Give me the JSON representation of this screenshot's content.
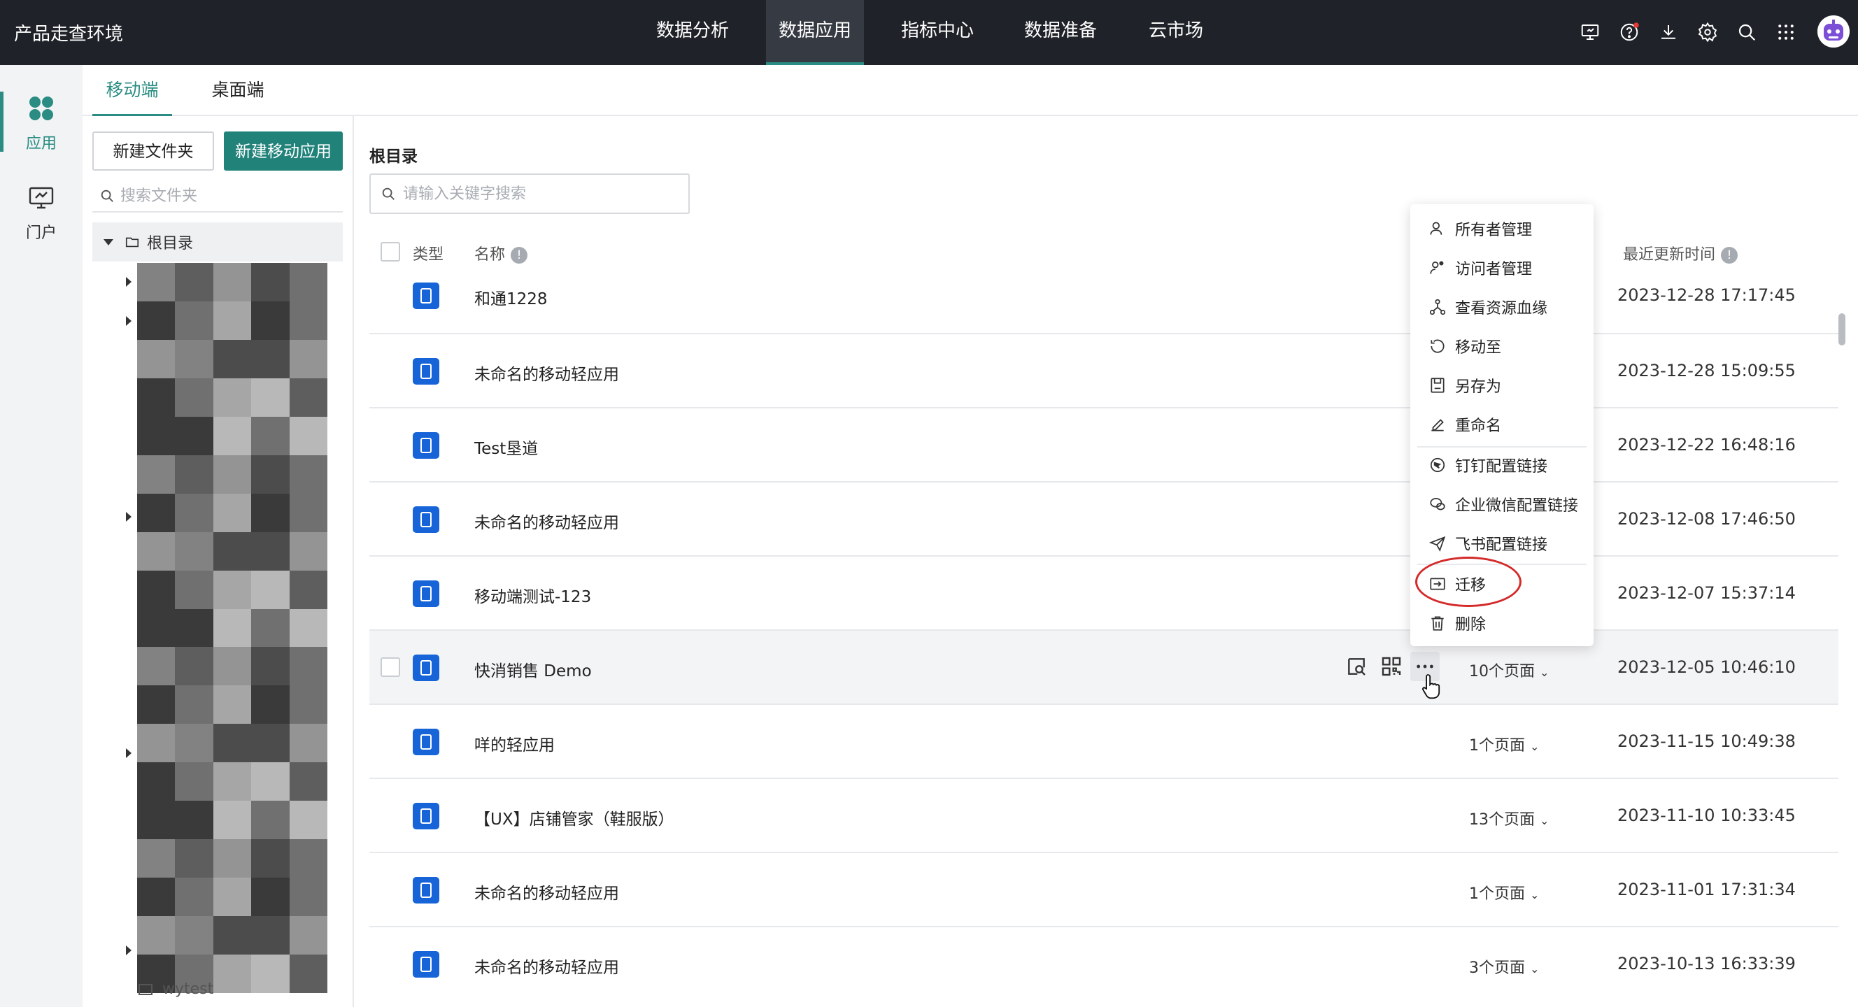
{
  "app": {
    "title": "产品走查环境"
  },
  "nav": {
    "items": [
      {
        "label": "数据分析",
        "active": false
      },
      {
        "label": "数据应用",
        "active": true
      },
      {
        "label": "指标中心",
        "active": false
      },
      {
        "label": "数据准备",
        "active": false
      },
      {
        "label": "云市场",
        "active": false
      }
    ]
  },
  "top_icons": [
    "screen-icon",
    "help-icon",
    "download-icon",
    "settings-icon",
    "search-icon",
    "apps-grid-icon"
  ],
  "left_rail": {
    "items": [
      {
        "label": "应用",
        "icon": "apps-icon",
        "active": true
      },
      {
        "label": "门户",
        "icon": "portal-icon",
        "active": false
      }
    ]
  },
  "tabs": [
    {
      "label": "移动端",
      "active": true
    },
    {
      "label": "桌面端",
      "active": false
    }
  ],
  "folder_panel": {
    "new_folder_label": "新建文件夹",
    "new_app_label": "新建移动应用",
    "search_placeholder": "搜索文件夹",
    "root_label": "根目录",
    "last_item_label": "wytest"
  },
  "main": {
    "breadcrumb": "根目录",
    "search_placeholder": "请输入关键字搜索",
    "headers": {
      "type": "类型",
      "name": "名称",
      "updated": "最近更新时间"
    },
    "rows": [
      {
        "name": "和通1228",
        "pages": "",
        "time": "2023-12-28 17:17:45"
      },
      {
        "name": "未命名的移动轻应用",
        "pages": "",
        "time": "2023-12-28 15:09:55"
      },
      {
        "name": "Test垦道",
        "pages": "",
        "time": "2023-12-22 16:48:16"
      },
      {
        "name": "未命名的移动轻应用",
        "pages": "",
        "time": "2023-12-08 17:46:50"
      },
      {
        "name": "移动端测试-123",
        "pages": "",
        "time": "2023-12-07 15:37:14"
      },
      {
        "name": "快消销售 Demo",
        "pages": "10个页面",
        "time": "2023-12-05 10:46:10"
      },
      {
        "name": "咩的轻应用",
        "pages": "1个页面",
        "time": "2023-11-15 10:49:38"
      },
      {
        "name": "【UX】店铺管家（鞋服版）",
        "pages": "13个页面",
        "time": "2023-11-10 10:33:45"
      },
      {
        "name": "未命名的移动轻应用",
        "pages": "1个页面",
        "time": "2023-11-01 17:31:34"
      },
      {
        "name": "未命名的移动轻应用",
        "pages": "3个页面",
        "time": "2023-10-13 16:33:39"
      }
    ]
  },
  "context_menu": {
    "items": [
      {
        "label": "所有者管理",
        "icon": "owner-icon"
      },
      {
        "label": "访问者管理",
        "icon": "visitor-icon"
      },
      {
        "label": "查看资源血缘",
        "icon": "lineage-icon"
      },
      {
        "label": "移动至",
        "icon": "move-icon"
      },
      {
        "label": "另存为",
        "icon": "save-as-icon"
      },
      {
        "label": "重命名",
        "icon": "rename-icon"
      },
      {
        "label": "钉钉配置链接",
        "icon": "dingtalk-icon"
      },
      {
        "label": "企业微信配置链接",
        "icon": "wecom-icon"
      },
      {
        "label": "飞书配置链接",
        "icon": "feishu-icon"
      },
      {
        "label": "迁移",
        "icon": "migrate-icon"
      },
      {
        "label": "删除",
        "icon": "delete-icon"
      }
    ]
  },
  "colors": {
    "topbar": "#1f2228",
    "accent": "#2a8c82",
    "primary_button": "#21827a",
    "app_icon": "#1664d8",
    "annotation": "#d42a2a"
  }
}
